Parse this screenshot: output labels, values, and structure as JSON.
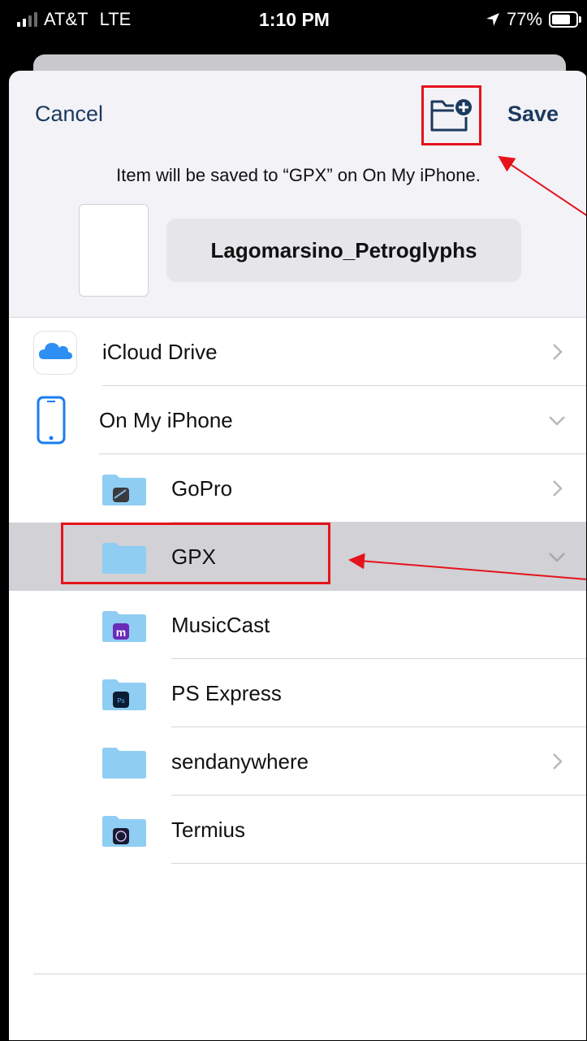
{
  "status_bar": {
    "carrier": "AT&T",
    "network": "LTE",
    "time": "1:10 PM",
    "battery": "77%"
  },
  "nav": {
    "cancel_label": "Cancel",
    "save_label": "Save"
  },
  "subtitle": "Item will be saved to “GPX” on On My iPhone.",
  "filename": "Lagomarsino_Petroglyphs",
  "locations": [
    {
      "label": "iCloud Drive",
      "chevron": "right"
    },
    {
      "label": "On My iPhone",
      "chevron": "down"
    }
  ],
  "folders": [
    {
      "label": "GoPro",
      "chevron": "right",
      "badge": "gopro-app-icon"
    },
    {
      "label": "GPX",
      "chevron": "down",
      "selected": true
    },
    {
      "label": "MusicCast",
      "badge": "musiccast-app-icon"
    },
    {
      "label": "PS Express",
      "badge": "ps-express-app-icon"
    },
    {
      "label": "sendanywhere",
      "chevron": "right"
    },
    {
      "label": "Termius",
      "badge": "termius-app-icon"
    }
  ],
  "colors": {
    "highlight_red": "#e5131b",
    "tint": "#1c3a5e",
    "folder_blue": "#8fcdf3",
    "selected_row": "#d1d1d6"
  }
}
